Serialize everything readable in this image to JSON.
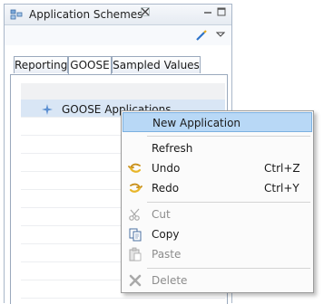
{
  "view": {
    "title": "Application Schemes",
    "close_icon": "close-x-icon",
    "icon": "application-schemes-icon"
  },
  "toolbar": {
    "edit_icon": "pen-icon",
    "menu_icon": "view-menu-chevron-icon"
  },
  "tabs": [
    {
      "label": "Reporting",
      "active": false
    },
    {
      "label": "GOOSE",
      "active": true
    },
    {
      "label": "Sampled Values",
      "active": false
    }
  ],
  "tree": {
    "items": [
      {
        "label": "GOOSE Applications",
        "icon": "goose-node-icon"
      }
    ]
  },
  "context_menu": {
    "items": [
      {
        "label": "New  Application",
        "highlighted": true,
        "enabled": true
      },
      {
        "label": "Refresh",
        "enabled": true
      },
      {
        "label": "Undo",
        "shortcut": "Ctrl+Z",
        "icon": "undo-arrow-icon",
        "enabled": true
      },
      {
        "label": "Redo",
        "shortcut": "Ctrl+Y",
        "icon": "redo-arrow-icon",
        "enabled": true
      },
      {
        "label": "Cut",
        "icon": "scissors-icon",
        "enabled": false
      },
      {
        "label": "Copy",
        "icon": "copy-icon",
        "enabled": true
      },
      {
        "label": "Paste",
        "icon": "paste-icon",
        "enabled": false
      },
      {
        "label": "Delete",
        "icon": "delete-x-icon",
        "enabled": false
      }
    ]
  },
  "colors": {
    "highlight": "#b8d8f6",
    "undo_redo_arrow": "#e8b62a",
    "tree_node": "#5b8fd1"
  }
}
